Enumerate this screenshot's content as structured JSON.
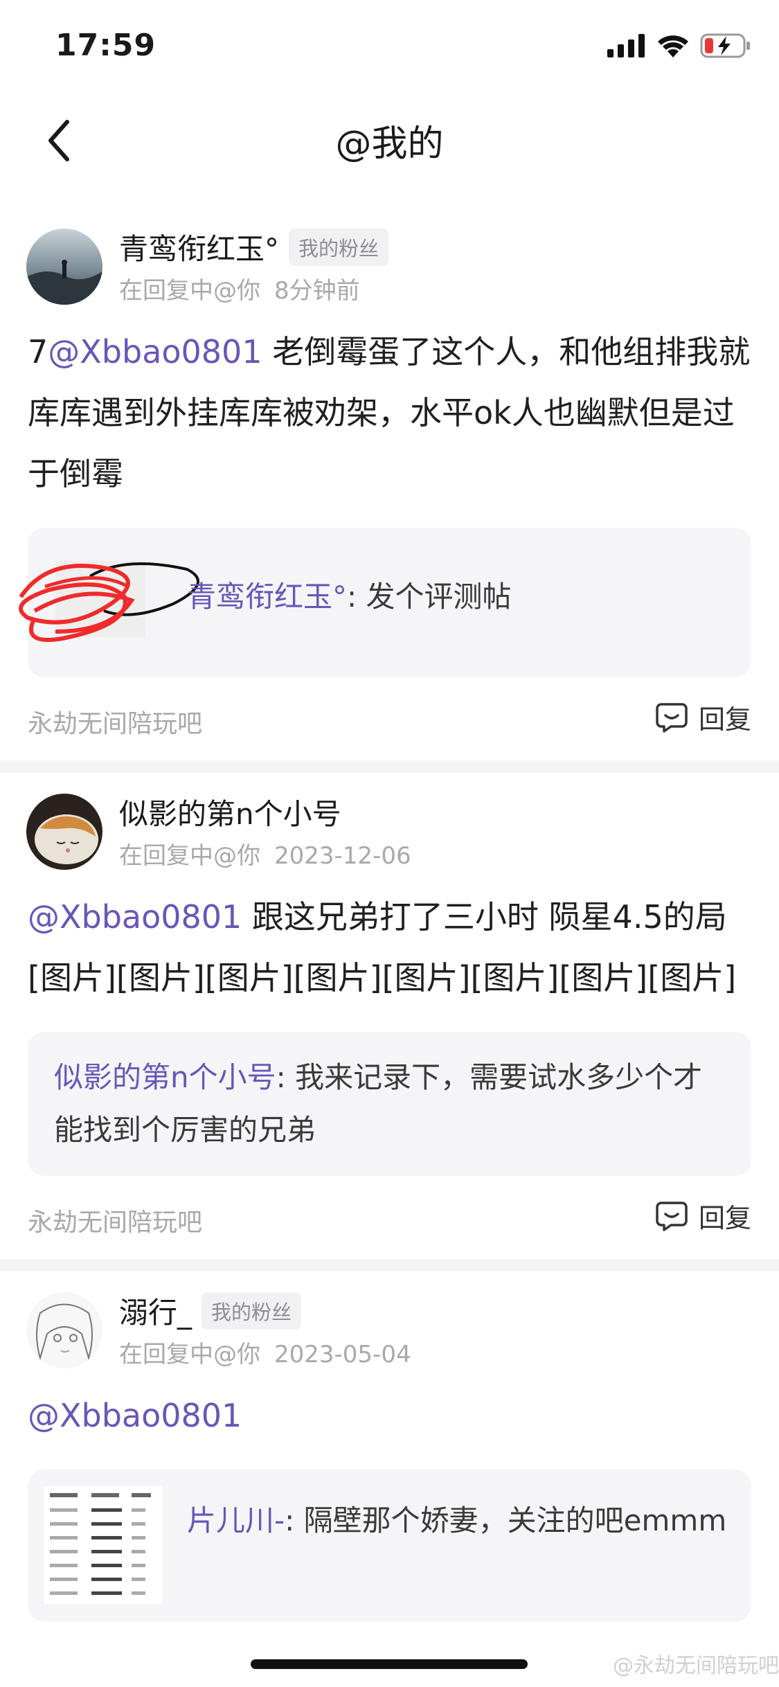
{
  "status": {
    "time": "17:59"
  },
  "nav": {
    "title": "@我的"
  },
  "posts": [
    {
      "username": "青鸾衔红玉°",
      "badge": "我的粉丝",
      "meta_prefix": "在回复中@你",
      "time": "8分钟前",
      "body_lead": "7",
      "mention": "@Xbbao0801",
      "body_rest": " 老倒霉蛋了这个人，和他组排我就库库遇到外挂库库被劝架，水平ok人也幽默但是过于倒霉",
      "quote_name": "青鸾衔红玉°",
      "quote_text": ": 发个评测帖",
      "forum": "永劫无间陪玩吧",
      "reply_label": "回复"
    },
    {
      "username": "似影的第n个小号",
      "badge": "",
      "meta_prefix": "在回复中@你",
      "time": "2023-12-06",
      "body_lead": "",
      "mention": "@Xbbao0801",
      "body_rest": " 跟这兄弟打了三小时 陨星4.5的局[图片][图片][图片][图片][图片][图片][图片][图片]",
      "quote_name": "似影的第n个小号",
      "quote_text": ": 我来记录下，需要试水多少个才能找到个厉害的兄弟",
      "forum": "永劫无间陪玩吧",
      "reply_label": "回复"
    },
    {
      "username": "溺行_",
      "badge": "我的粉丝",
      "meta_prefix": "在回复中@你",
      "time": "2023-05-04",
      "body_lead": "",
      "mention": "@Xbbao0801",
      "body_rest": "",
      "quote_name": "片儿川-",
      "quote_text": ": 隔壁那个娇妻，关注的吧emmm"
    }
  ],
  "watermark": "@永劫无间陪玩吧",
  "colors": {
    "accent": "#6657b8",
    "muted": "#a8a8ad",
    "quote_bg": "#f5f5f7",
    "separator": "#f3f3f5"
  }
}
